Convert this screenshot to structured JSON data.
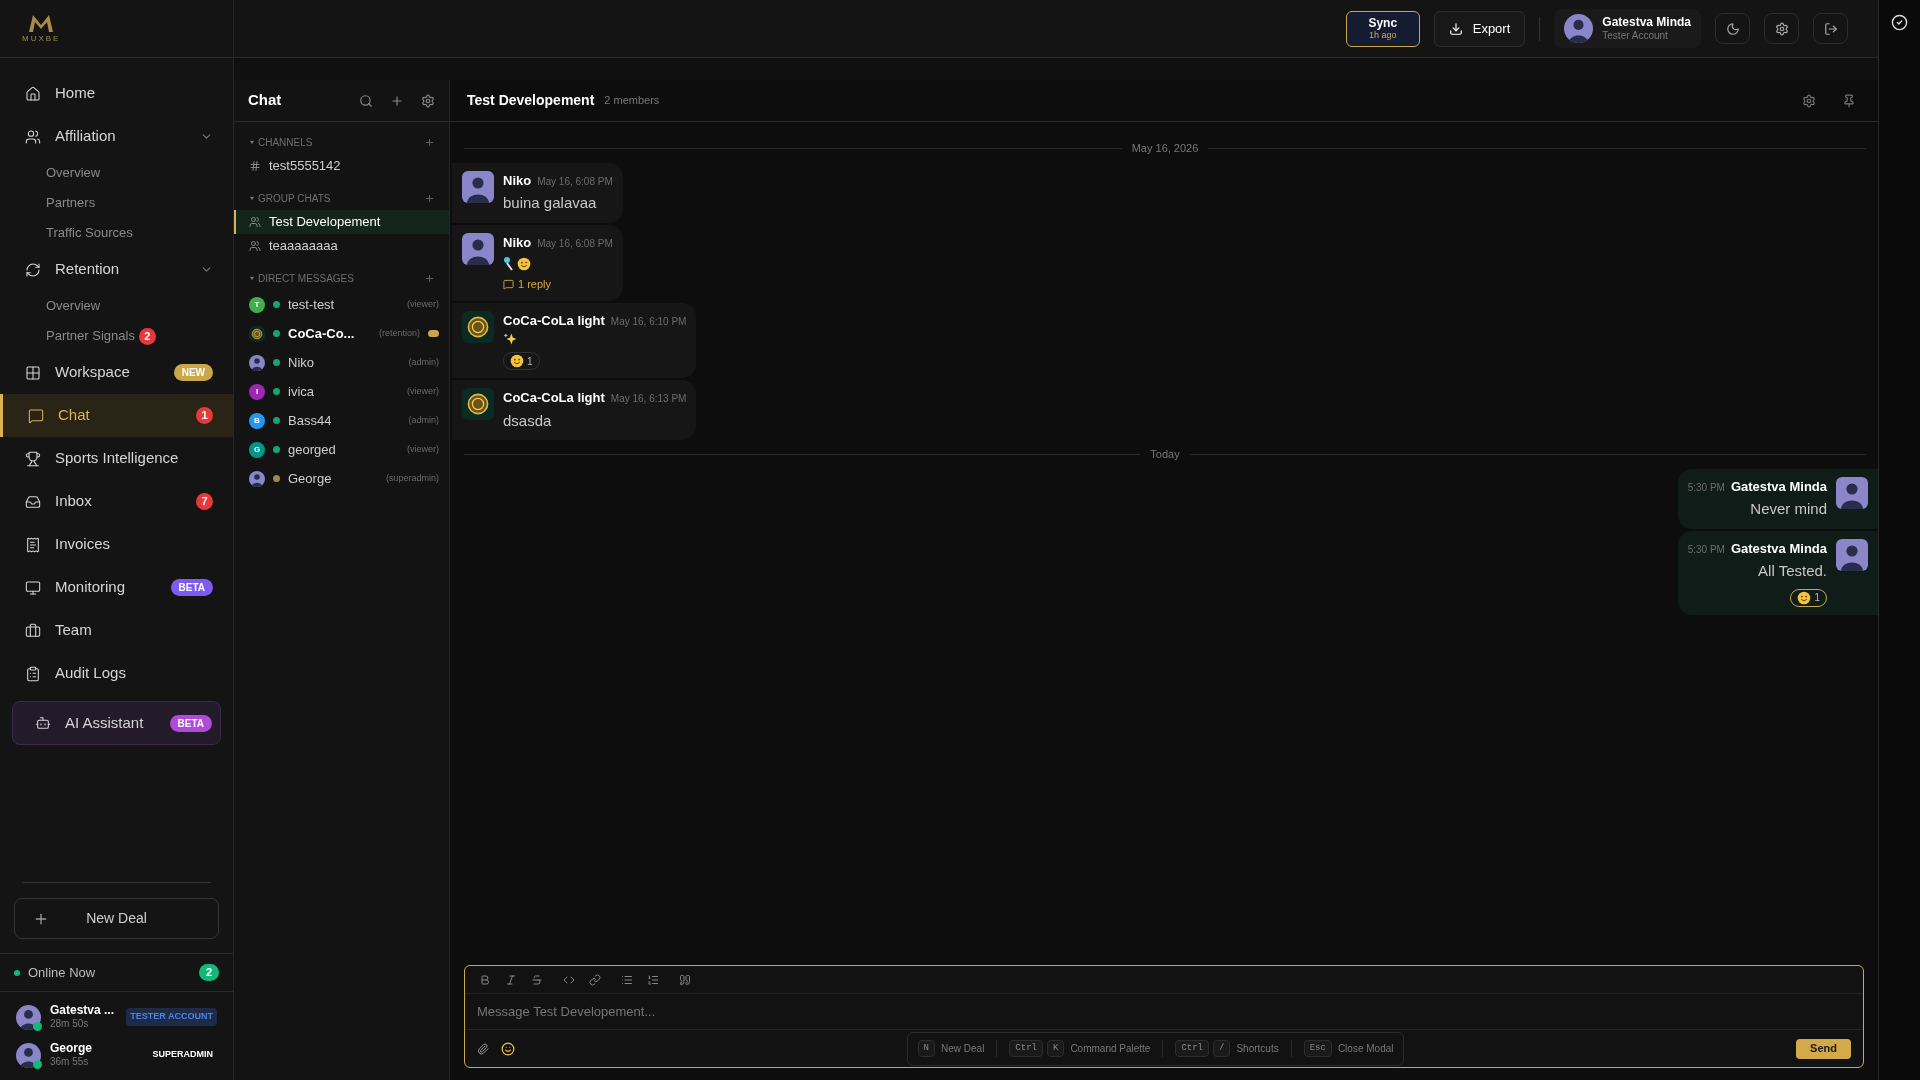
{
  "brand": {
    "name": "MUXBE"
  },
  "nav": [
    {
      "label": "Home",
      "selected": false
    },
    {
      "label": "Affiliation",
      "selected": false,
      "expanded": true,
      "children": [
        {
          "label": "Overview"
        },
        {
          "label": "Partners"
        },
        {
          "label": "Traffic Sources"
        }
      ]
    },
    {
      "label": "Retention",
      "selected": false,
      "expanded": true,
      "children": [
        {
          "label": "Overview"
        },
        {
          "label": "Partner Signals",
          "badge": "2"
        }
      ]
    },
    {
      "label": "Workspace",
      "selected": false,
      "tag": {
        "text": "NEW",
        "kind": "new"
      }
    },
    {
      "label": "Chat",
      "selected": true,
      "badge": "1"
    },
    {
      "label": "Sports Intelligence",
      "selected": false
    },
    {
      "label": "Inbox",
      "selected": false,
      "badge": "7"
    },
    {
      "label": "Invoices",
      "selected": false
    },
    {
      "label": "Monitoring",
      "selected": false,
      "tag": {
        "text": "BETA",
        "kind": "beta"
      }
    },
    {
      "label": "Team",
      "selected": false
    },
    {
      "label": "Audit Logs",
      "selected": false
    }
  ],
  "ai_assistant": {
    "label": "AI Assistant",
    "tag": {
      "text": "BETA",
      "kind": "ai"
    }
  },
  "new_deal": "New Deal",
  "online": {
    "title": "Online Now",
    "count": "2",
    "users": [
      {
        "name": "Gatestva ...",
        "time": "28m 50s",
        "role": {
          "text": "TESTER ACCOUNT",
          "kind": "tester"
        }
      },
      {
        "name": "George",
        "time": "36m 55s",
        "role": {
          "text": "SUPERADMIN",
          "kind": "superadmin"
        }
      }
    ]
  },
  "header": {
    "sync": {
      "label": "Sync",
      "sub": "1h ago"
    },
    "export": "Export",
    "user": {
      "name": "Gatestva Minda",
      "role": "Tester Account"
    }
  },
  "chat_list": {
    "title": "Chat",
    "sections": [
      {
        "title": "CHANNELS",
        "kind": "channel",
        "items": [
          {
            "name": "test5555142",
            "selected": false
          }
        ]
      },
      {
        "title": "GROUP CHATS",
        "kind": "group",
        "items": [
          {
            "name": "Test Developement",
            "selected": true
          },
          {
            "name": "teaaaaaaaa",
            "selected": false
          }
        ]
      },
      {
        "title": "DIRECT MESSAGES",
        "kind": "dm",
        "items": [
          {
            "name": "test-test",
            "role": "(viewer)",
            "avatar": {
              "kind": "letter",
              "initial": "T",
              "color": "#3cb04a"
            },
            "status": {
              "color": "#14a66f"
            },
            "unread": false,
            "selected": false
          },
          {
            "name": "CoCa-Co...",
            "role": "(retention)",
            "avatar": {
              "kind": "coin"
            },
            "status": {
              "color": "#14a66f"
            },
            "unread": true,
            "selected": false
          },
          {
            "name": "Niko",
            "role": "(admin)",
            "avatar": {
              "kind": "person"
            },
            "status": {
              "color": "#14a66f"
            },
            "unread": false,
            "selected": false
          },
          {
            "name": "ivica",
            "role": "(viewer)",
            "avatar": {
              "kind": "letter",
              "initial": "I",
              "color": "#9c27b0"
            },
            "status": {
              "color": "#14a66f"
            },
            "unread": false,
            "selected": false
          },
          {
            "name": "Bass44",
            "role": "(admin)",
            "avatar": {
              "kind": "letter",
              "initial": "B",
              "color": "#2196f3"
            },
            "status": {
              "color": "#14a66f"
            },
            "unread": false,
            "selected": false
          },
          {
            "name": "georged",
            "role": "(viewer)",
            "avatar": {
              "kind": "letter",
              "initial": "G",
              "color": "#009688"
            },
            "status": {
              "color": "#14a66f"
            },
            "unread": false,
            "selected": false
          },
          {
            "name": "George",
            "role": "(superadmin)",
            "avatar": {
              "kind": "person"
            },
            "status": {
              "color": "#a08a3c"
            },
            "unread": false,
            "selected": false
          }
        ]
      }
    ]
  },
  "conversation": {
    "title": "Test Developement",
    "members": "2 members",
    "timeline": [
      {
        "kind": "divider",
        "label": "May 16, 2026"
      },
      {
        "kind": "message",
        "own": false,
        "avatar": {
          "kind": "person"
        },
        "author": "Niko",
        "time": "May 16, 6:08 PM",
        "body": {
          "kind": "text",
          "text": "buina galavaa"
        }
      },
      {
        "kind": "message",
        "own": false,
        "avatar": {
          "kind": "person"
        },
        "author": "Niko",
        "time": "May 16, 6:08 PM",
        "body": {
          "kind": "pin-wink"
        },
        "reply": "1 reply"
      },
      {
        "kind": "message",
        "own": false,
        "avatar": {
          "kind": "coin"
        },
        "author": "CoCa-CoLa light",
        "time": "May 16, 6:10 PM",
        "body": {
          "kind": "sparkles"
        },
        "reaction": "1"
      },
      {
        "kind": "message",
        "own": false,
        "avatar": {
          "kind": "coin"
        },
        "author": "CoCa-CoLa light",
        "time": "May 16, 6:13 PM",
        "body": {
          "kind": "text",
          "text": "dsasda"
        }
      },
      {
        "kind": "divider",
        "label": "Today"
      },
      {
        "kind": "message",
        "own": true,
        "avatar": {
          "kind": "person"
        },
        "author": "Gatestva Minda",
        "time": "5:30 PM",
        "body": {
          "kind": "text",
          "text": "Never mind"
        }
      },
      {
        "kind": "message",
        "own": true,
        "avatar": {
          "kind": "person"
        },
        "author": "Gatestva Minda",
        "time": "5:30 PM",
        "body": {
          "kind": "text",
          "text": "All Tested."
        },
        "reaction": "1"
      }
    ]
  },
  "composer": {
    "placeholder": "Message Test Developement...",
    "send": "Send",
    "hints": [
      {
        "keys": [
          "N"
        ],
        "label": "New Deal"
      },
      {
        "keys": [
          "Ctrl",
          "K"
        ],
        "label": "Command Palette"
      },
      {
        "keys": [
          "Ctrl",
          "/"
        ],
        "label": "Shortcuts"
      },
      {
        "keys": [
          "Esc"
        ],
        "label": "Close Modal"
      }
    ]
  }
}
